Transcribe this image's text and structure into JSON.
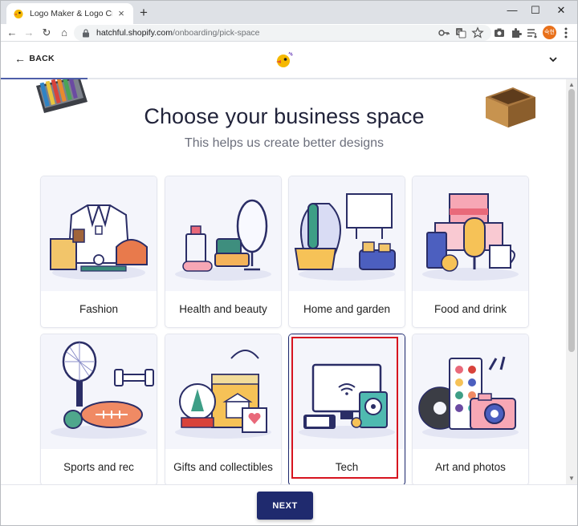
{
  "browser": {
    "tab_title": "Logo Maker & Logo Creator - Free",
    "tab_close_glyph": "×",
    "new_tab_glyph": "+",
    "url_host": "hatchful.shopify.com",
    "url_path": "/onboarding/pick-space",
    "profile_initials": "숙현",
    "window_controls": {
      "minimize": "—",
      "maximize": "☐",
      "close": "✕"
    },
    "nav": {
      "back": "←",
      "forward": "→",
      "reload": "↻",
      "home": "⌂"
    }
  },
  "header": {
    "back_label": "BACK",
    "back_arrow": "←",
    "progress_fraction": 0.15
  },
  "main": {
    "title": "Choose your business space",
    "subtitle": "This helps us create better designs",
    "cards": [
      {
        "label": "Fashion"
      },
      {
        "label": "Health and beauty"
      },
      {
        "label": "Home and garden"
      },
      {
        "label": "Food and drink"
      },
      {
        "label": "Sports and rec"
      },
      {
        "label": "Gifts and collectibles"
      },
      {
        "label": "Tech",
        "selected": true
      },
      {
        "label": "Art and photos"
      }
    ]
  },
  "footer": {
    "next_label": "NEXT"
  },
  "colors": {
    "primary": "#1f2a6e",
    "selection_outline": "#d7141f",
    "illustration_bg": "#f4f5fb"
  }
}
